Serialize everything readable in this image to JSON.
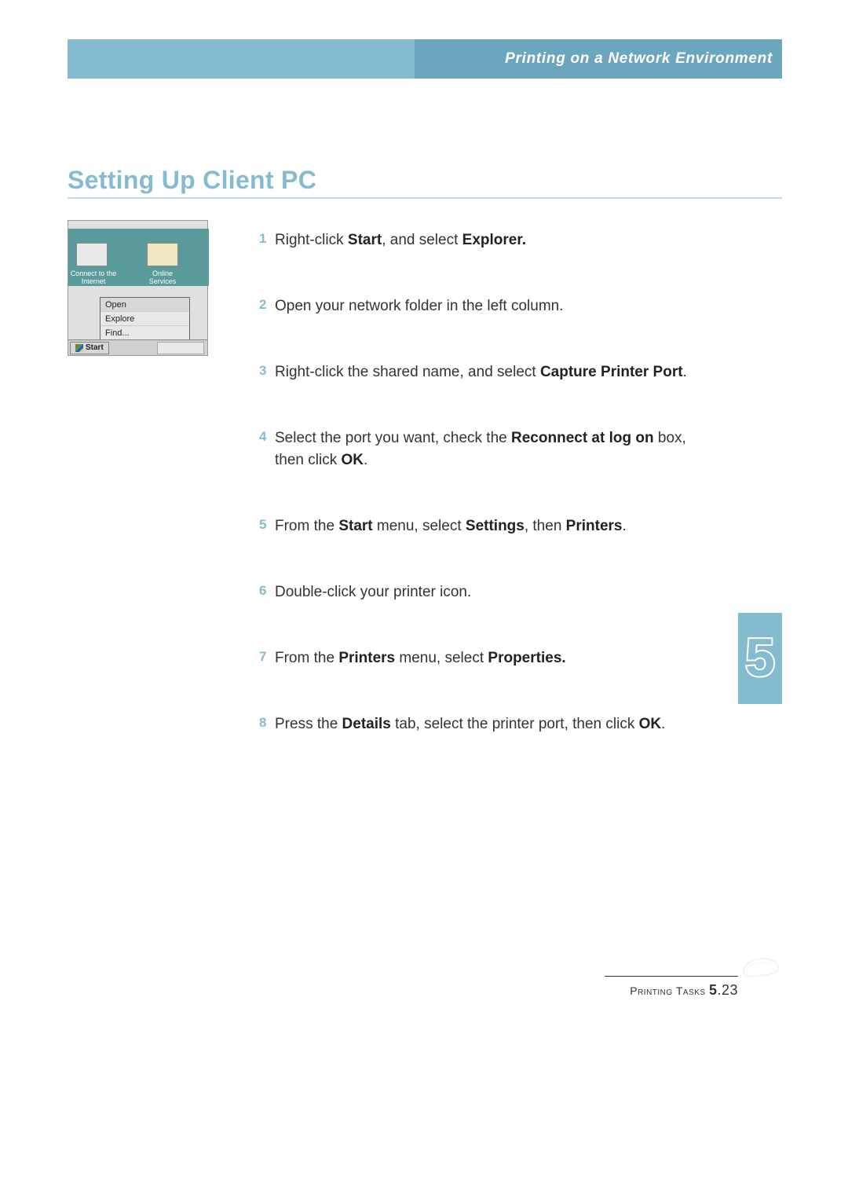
{
  "header": {
    "title": "Printing on a Network Environment"
  },
  "section": {
    "title": "Setting Up Client PC"
  },
  "screenshot": {
    "icon_labels": [
      "Connect to the Internet",
      "Online Services"
    ],
    "menu_items": [
      "Open",
      "Explore",
      "Find..."
    ],
    "start_label": "Start"
  },
  "steps": [
    {
      "n": "1",
      "parts": [
        {
          "t": "Right-click "
        },
        {
          "t": "Start",
          "b": true
        },
        {
          "t": ", and select "
        },
        {
          "t": "Explorer.",
          "b": true
        }
      ]
    },
    {
      "n": "2",
      "parts": [
        {
          "t": "Open your network folder in the left column."
        }
      ]
    },
    {
      "n": "3",
      "parts": [
        {
          "t": "Right-click the shared name, and select "
        },
        {
          "t": "Capture Printer Port",
          "b": true
        },
        {
          "t": "."
        }
      ]
    },
    {
      "n": "4",
      "parts": [
        {
          "t": "Select the port you want, check the "
        },
        {
          "t": "Reconnect at log on",
          "b": true
        },
        {
          "t": " box, then click "
        },
        {
          "t": "OK",
          "b": true
        },
        {
          "t": "."
        }
      ]
    },
    {
      "n": "5",
      "parts": [
        {
          "t": "From the "
        },
        {
          "t": "Start",
          "b": true
        },
        {
          "t": " menu, select "
        },
        {
          "t": "Settings",
          "b": true
        },
        {
          "t": ", then "
        },
        {
          "t": "Printers",
          "b": true
        },
        {
          "t": "."
        }
      ]
    },
    {
      "n": "6",
      "parts": [
        {
          "t": "Double-click your printer icon."
        }
      ]
    },
    {
      "n": "7",
      "parts": [
        {
          "t": "From the "
        },
        {
          "t": "Printers",
          "b": true
        },
        {
          "t": " menu, select "
        },
        {
          "t": "Properties.",
          "b": true
        }
      ]
    },
    {
      "n": "8",
      "parts": [
        {
          "t": "Press the "
        },
        {
          "t": "Details",
          "b": true
        },
        {
          "t": " tab, select the printer port, then click "
        },
        {
          "t": "OK",
          "b": true
        },
        {
          "t": "."
        }
      ]
    }
  ],
  "chapter_number": "5",
  "footer": {
    "section": "Printing Tasks",
    "page_major": "5",
    "page_minor": ".23"
  }
}
